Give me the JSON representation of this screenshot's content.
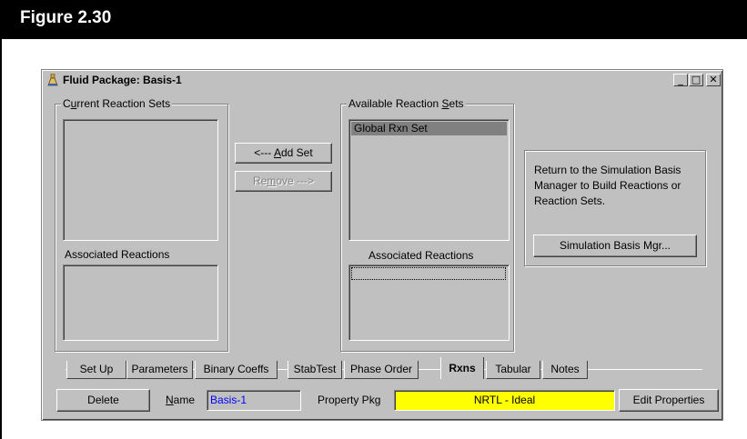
{
  "figure": {
    "title": "Figure 2.30"
  },
  "window": {
    "title": "Fluid Package: Basis-1",
    "controls": {
      "minimize": "_",
      "maximize": "□",
      "close": "✕"
    }
  },
  "current_sets": {
    "label_pre": "C",
    "label_accel": "u",
    "label_post": "rrent Reaction Sets",
    "associated_label": "Associated Reactions"
  },
  "available_sets": {
    "label_pre": "Available Reaction ",
    "label_accel": "S",
    "label_post": "ets",
    "items": [
      "Global Rxn Set"
    ],
    "associated_label": "Associated Reactions"
  },
  "buttons": {
    "add_pre": "<--- ",
    "add_accel": "A",
    "add_post": "dd Set",
    "remove_pre": "Re",
    "remove_accel": "m",
    "remove_post": "ove --->",
    "sim_basis": "Simulation Basis Mgr...",
    "delete": "Delete",
    "edit_properties": "Edit Properties"
  },
  "info": {
    "text": "Return to the Simulation Basis Manager to Build Reactions or Reaction Sets."
  },
  "tabs": [
    "Set Up",
    "Parameters",
    "Binary Coeffs",
    "StabTest",
    "Phase Order",
    "Rxns",
    "Tabular",
    "Notes"
  ],
  "active_tab": "Rxns",
  "footer": {
    "name_accel": "N",
    "name_post": "ame",
    "name_value": "Basis-1",
    "property_pkg_label": "Property Pkg",
    "property_pkg_value": "NRTL - Ideal"
  },
  "colors": {
    "highlight": "#ffff00",
    "name_text": "#0000ff",
    "selection": "#808080"
  }
}
